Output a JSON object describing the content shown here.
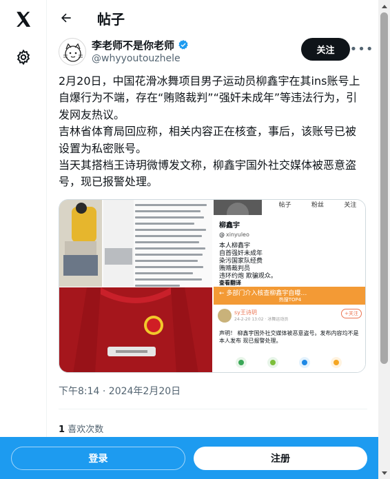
{
  "header": {
    "title": "帖子"
  },
  "author": {
    "name": "李老师不是你老师",
    "handle": "@whyyoutouzhele",
    "follow_label": "关注",
    "more_label": "•••"
  },
  "tweet": {
    "paragraphs": [
      "2月20日，中国花滑冰舞项目男子运动员柳鑫宇在其ins账号上自爆行为不端，存在“贿赂裁判”“强奸未成年”等违法行为，引发网友热议。",
      "吉林省体育局回应称，相关内容正在核查，事后，该账号已被设置为私密账号。",
      "当天其搭档王诗玥微博发文称，柳鑫宇国外社交媒体被恶意盗号，现已报警处理。"
    ],
    "timestamp": "下午8:14 · 2024年2月20日",
    "stats": {
      "count": "1",
      "label": "喜欢次数"
    }
  },
  "media": {
    "profile": {
      "stats": [
        "帖子",
        "粉丝",
        "关注"
      ],
      "name": "柳鑫宇",
      "handle": "xinyuleo",
      "bio": [
        "本人柳鑫宇",
        "自首强奸未成年",
        "染污国家队经费",
        "贿赂裁判员",
        "违环约炮 欺骗观众。"
      ],
      "translate": "查看翻译"
    },
    "weibo": {
      "banner_top": "←  多部门介入核查柳鑫宇自曝…",
      "banner_sub": "热搜TOP4",
      "user": "sy王诗玥",
      "meta": "24-2-20 13:02 · 冰舞运动员",
      "follow": "+关注",
      "post": "声明！ 柳鑫宇国外社交媒体被恶意盗号。发布内容均不是本人发布 现已报警处理。"
    }
  },
  "bottom": {
    "login_label": "登录",
    "signup_label": "注册"
  },
  "colors": {
    "accent": "#1d9bf0",
    "verified": "#1d9bf0",
    "jersey": "#a5161c"
  }
}
